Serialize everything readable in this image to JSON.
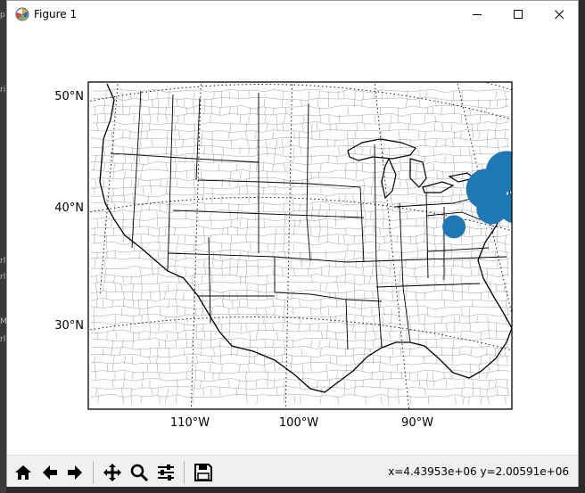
{
  "window": {
    "title": "Figure 1",
    "icons": {
      "app": "matplotlib-icon",
      "minimize": "minimize-icon",
      "maximize": "maximize-icon",
      "close": "close-icon"
    }
  },
  "chart_data": {
    "type": "scatter",
    "projection": "lambert-conformal-conic",
    "basemap": "us-counties-and-states",
    "ytick_labels": [
      "50°N",
      "40°N",
      "30°N"
    ],
    "xtick_labels": [
      "110°W",
      "100°W",
      "90°W"
    ],
    "graticule": "dotted",
    "series": [
      {
        "color": "#1f77b4",
        "points": [
          {
            "lon": -81.0,
            "lat": 43.0,
            "size": "large"
          },
          {
            "lon": -83.0,
            "lat": 41.5,
            "size": "large"
          },
          {
            "lon": -82.5,
            "lat": 39.8,
            "size": "medium"
          },
          {
            "lon": -80.2,
            "lat": 39.9,
            "size": "medium"
          },
          {
            "lon": -86.3,
            "lat": 38.3,
            "size": "small"
          }
        ]
      }
    ]
  },
  "toolbar": {
    "items": [
      {
        "name": "home-icon"
      },
      {
        "name": "back-arrow-icon"
      },
      {
        "name": "forward-arrow-icon"
      },
      {
        "name": "pan-icon"
      },
      {
        "name": "zoom-icon"
      },
      {
        "name": "configure-subplots-icon"
      },
      {
        "name": "save-icon"
      }
    ],
    "coords": "x=4.43953e+06  y=2.00591e+06"
  },
  "background_window": {
    "fragments": [
      "p",
      "ri",
      "rl",
      "M",
      "rl",
      "rl"
    ]
  }
}
